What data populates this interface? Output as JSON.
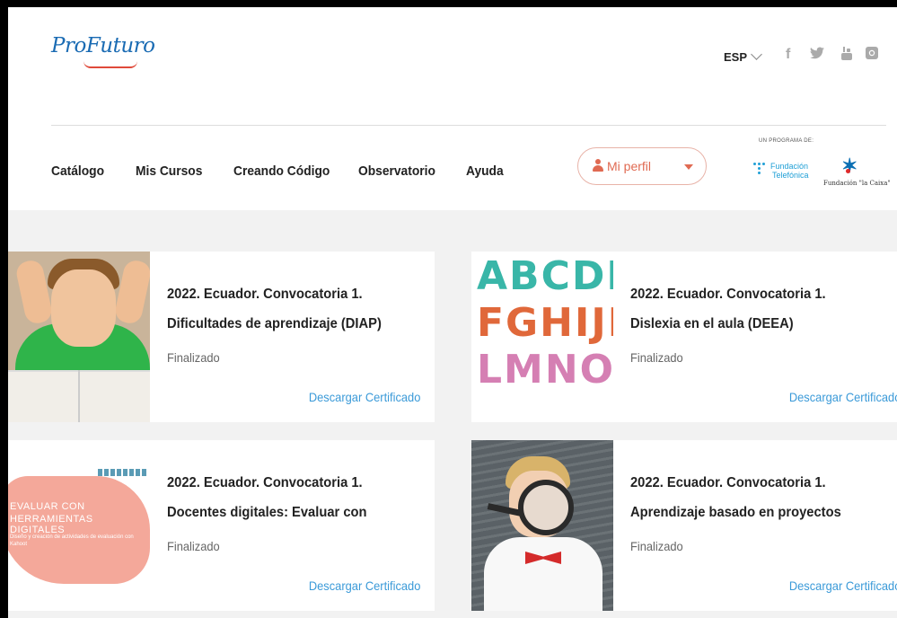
{
  "header": {
    "logo": "ProFuturo",
    "language": "ESP",
    "social": [
      "facebook-icon",
      "twitter-icon",
      "youtube-icon",
      "instagram-icon"
    ]
  },
  "nav": {
    "items": [
      "Catálogo",
      "Mis Cursos",
      "Creando Código",
      "Observatorio",
      "Ayuda"
    ],
    "profile_label": "Mi perfil"
  },
  "partners": {
    "label": "UN PROGRAMA DE:",
    "fundacion_telefonica_line1": "Fundación",
    "fundacion_telefonica_line2": "Telefónica",
    "la_caixa": "Fundación \"la Caixa\""
  },
  "courses": [
    {
      "title_line1": "2022. Ecuador. Convocatoria 1.",
      "title_line2": "Dificultades de aprendizaje (DIAP)",
      "status": "Finalizado",
      "action": "Descargar Certificado"
    },
    {
      "title_line1": "2022. Ecuador. Convocatoria 1.",
      "title_line2": "Dislexia en el aula (DEEA)",
      "status": "Finalizado",
      "action": "Descargar Certificado",
      "thumb_letters": [
        "ABCDE",
        "FGHIJK",
        "LMNOP"
      ]
    },
    {
      "title_line1": "2022. Ecuador. Convocatoria 1.",
      "title_line2": "Docentes digitales: Evaluar con",
      "status": "Finalizado",
      "action": "Descargar Certificado",
      "thumb_text": [
        "EVALUAR CON",
        "HERRAMIENTAS DIGITALES",
        "Diseño y creación de actividades de evaluación con Kahoot"
      ]
    },
    {
      "title_line1": "2022. Ecuador. Convocatoria 1.",
      "title_line2": "Aprendizaje basado en proyectos",
      "status": "Finalizado",
      "action": "Descargar Certificado"
    }
  ],
  "colors": {
    "brand_blue": "#1a6bb3",
    "accent_coral": "#e06a52",
    "link_blue": "#3b9ad8"
  }
}
